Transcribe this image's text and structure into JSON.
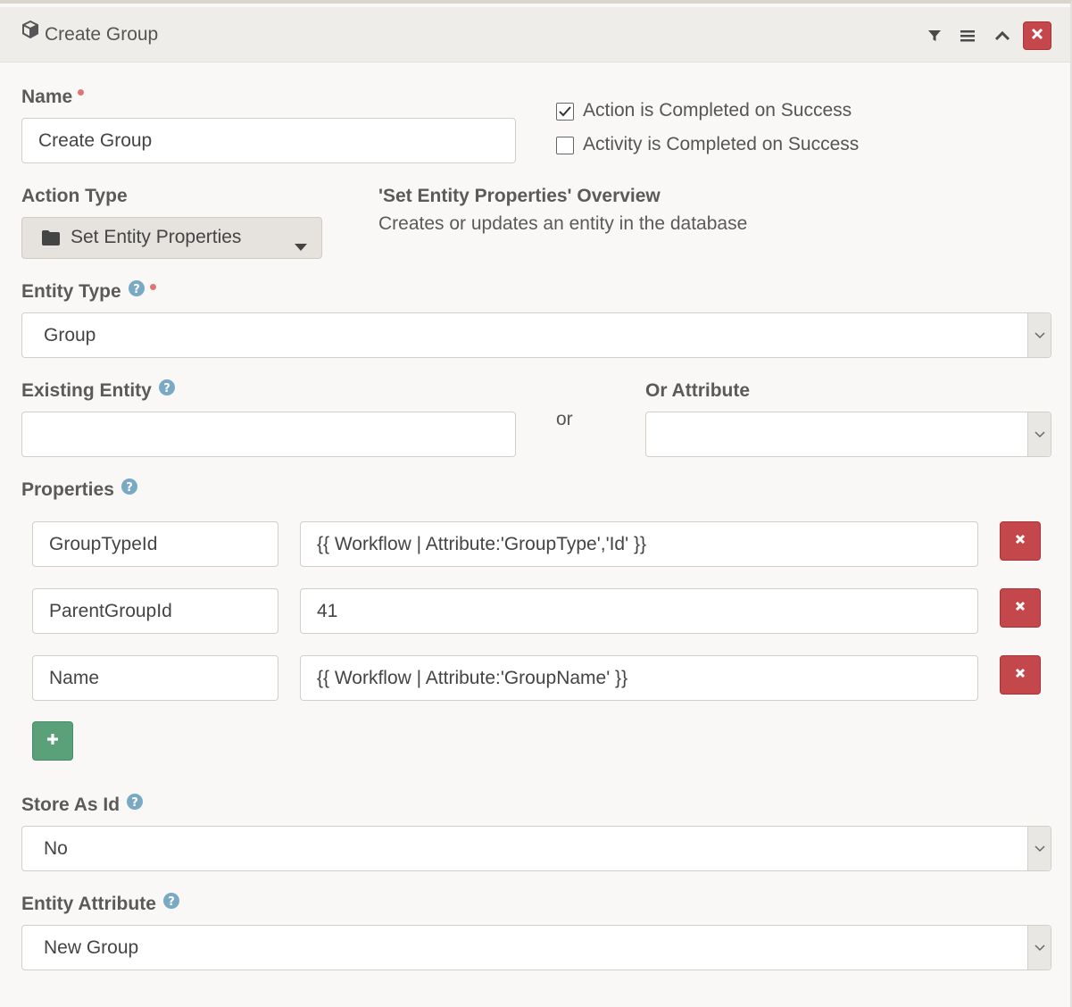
{
  "header": {
    "title": "Create Group",
    "icons": [
      "cube-icon",
      "filter-icon",
      "menu-icon",
      "chevron-up-icon",
      "close-icon"
    ]
  },
  "name": {
    "label": "Name",
    "value": "Create Group"
  },
  "checkboxes": [
    {
      "label": "Action is Completed on Success",
      "checked": true
    },
    {
      "label": "Activity is Completed on Success",
      "checked": false
    }
  ],
  "action_type": {
    "label": "Action Type",
    "value": "Set Entity Properties",
    "icon": "folder-icon"
  },
  "overview": {
    "title": "'Set Entity Properties' Overview",
    "text": "Creates or updates an entity in the database"
  },
  "entity_type": {
    "label": "Entity Type",
    "value": "Group"
  },
  "existing_entity": {
    "label": "Existing Entity",
    "value": ""
  },
  "or_text": "or",
  "or_attribute": {
    "label": "Or Attribute",
    "value": ""
  },
  "properties": {
    "label": "Properties",
    "rows": [
      {
        "key": "GroupTypeId",
        "value": "{{ Workflow | Attribute:'GroupType','Id' }}"
      },
      {
        "key": "ParentGroupId",
        "value": "41"
      },
      {
        "key": "Name",
        "value": "{{ Workflow | Attribute:'GroupName' }}"
      }
    ]
  },
  "store_as_id": {
    "label": "Store As Id",
    "value": "No"
  },
  "entity_attribute": {
    "label": "Entity Attribute",
    "value": "New Group"
  },
  "colors": {
    "danger": "#c4474c",
    "success": "#5aa17a",
    "required_dot": "#e07575",
    "help": "#7aa9c4"
  }
}
